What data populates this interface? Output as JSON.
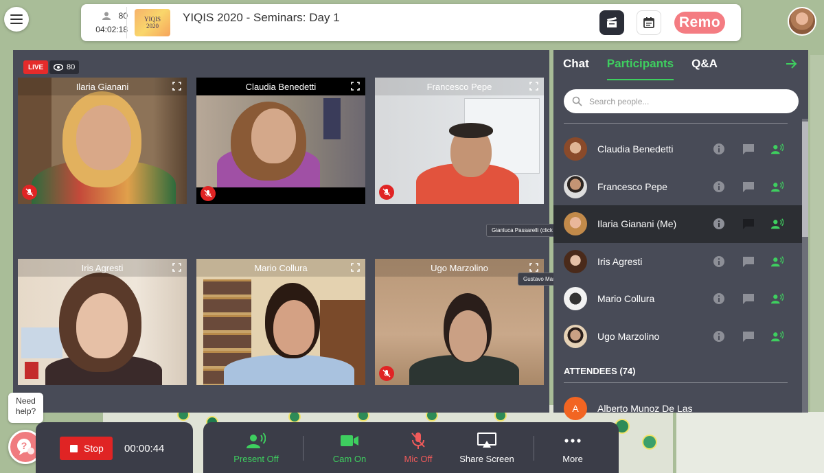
{
  "header": {
    "participant_count": "80",
    "elapsed": "04:02:18",
    "event_title": "YIQIS 2020 - Seminars: Day 1",
    "logo_line1": "YIQIS",
    "logo_line2": "2020",
    "brand": "Remo"
  },
  "stage": {
    "live_label": "LIVE",
    "viewer_count": "80",
    "tiles": [
      {
        "name": "Ilaria Gianani",
        "muted": true
      },
      {
        "name": "Claudia Benedetti",
        "muted": true
      },
      {
        "name": "Francesco Pepe",
        "muted": true
      },
      {
        "name": "Iris Agresti",
        "muted": false
      },
      {
        "name": "Mario Collura",
        "muted": false
      },
      {
        "name": "Ugo Marzolino",
        "muted": true
      }
    ],
    "tooltips": [
      "Gianluca Passarelli (click to view more)",
      "Gustavo Martin Bosyk (click to view more)"
    ]
  },
  "panel": {
    "tabs": [
      "Chat",
      "Participants",
      "Q&A"
    ],
    "active_tab": "Participants",
    "search_placeholder": "Search people...",
    "participants": [
      {
        "name": "Claudia Benedetti",
        "me": false
      },
      {
        "name": "Francesco Pepe",
        "me": false
      },
      {
        "name": "Ilaria Gianani (Me)",
        "me": true
      },
      {
        "name": "Iris Agresti",
        "me": false
      },
      {
        "name": "Mario Collura",
        "me": false
      },
      {
        "name": "Ugo Marzolino",
        "me": false
      }
    ],
    "attendees_header": "ATTENDEES (74)",
    "attendee_first": {
      "initial": "A",
      "name": "Alberto Munoz De Las"
    }
  },
  "recording": {
    "stop_label": "Stop",
    "timer": "00:00:44"
  },
  "controls": {
    "present": "Present Off",
    "cam": "Cam On",
    "mic": "Mic Off",
    "share": "Share Screen",
    "more": "More"
  },
  "help": {
    "line1": "Need",
    "line2": "help?"
  },
  "colors": {
    "accent_green": "#3ecf5f",
    "live_red": "#e52b2b",
    "brand_pink": "#f47c82",
    "panel_bg": "#484b57"
  }
}
